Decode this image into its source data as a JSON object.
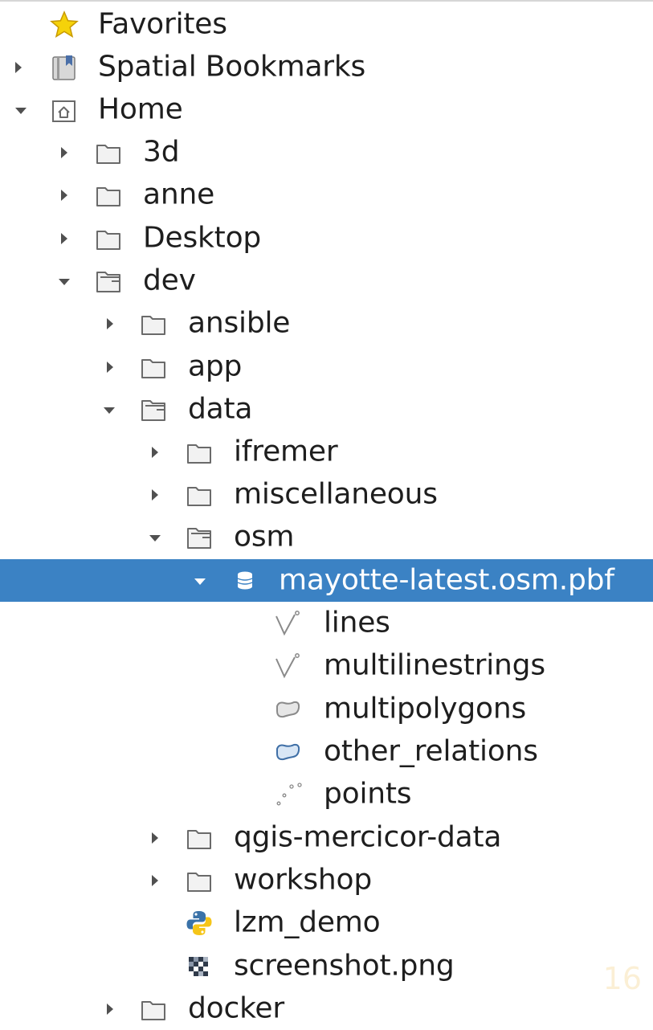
{
  "tree": {
    "favorites": "Favorites",
    "spatial_bookmarks": "Spatial Bookmarks",
    "home": "Home",
    "folder_3d": "3d",
    "folder_anne": "anne",
    "folder_desktop": "Desktop",
    "folder_dev": "dev",
    "folder_ansible": "ansible",
    "folder_app": "app",
    "folder_data": "data",
    "folder_ifremer": "ifremer",
    "folder_miscellaneous": "miscellaneous",
    "folder_osm": "osm",
    "file_pbf": "mayotte-latest.osm.pbf",
    "layer_lines": "lines",
    "layer_multilinestrings": "multilinestrings",
    "layer_multipolygons": "multipolygons",
    "layer_other_relations": "other_relations",
    "layer_points": "points",
    "folder_qgis": "qgis-mercicor-data",
    "folder_workshop": "workshop",
    "file_lzm": "lzm_demo",
    "file_screenshot": "screenshot.png",
    "folder_docker": "docker"
  },
  "watermark": "16",
  "colors": {
    "selection": "#3b82c4",
    "star": "#f5d20a"
  }
}
